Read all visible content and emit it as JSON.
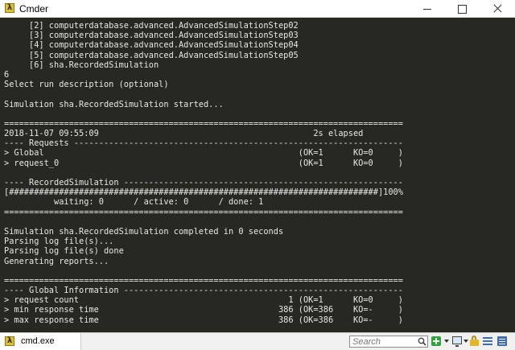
{
  "window": {
    "title": "Cmder",
    "icon": "lambda-icon",
    "app_glyph": "λ"
  },
  "terminal": {
    "background": "#272822",
    "foreground": "#e6e6e6",
    "lines": [
      "     [2] computerdatabase.advanced.AdvancedSimulationStep02",
      "     [3] computerdatabase.advanced.AdvancedSimulationStep03",
      "     [4] computerdatabase.advanced.AdvancedSimulationStep04",
      "     [5] computerdatabase.advanced.AdvancedSimulationStep05",
      "     [6] sha.RecordedSimulation",
      "6",
      "Select run description (optional)",
      "",
      "Simulation sha.RecordedSimulation started...",
      "",
      "================================================================================",
      "2018-11-07 09:55:09                                           2s elapsed",
      "---- Requests ------------------------------------------------------------------",
      "> Global                                                   (OK=1      KO=0     )",
      "> request_0                                                (OK=1      KO=0     )",
      "",
      "---- RecordedSimulation --------------------------------------------------------",
      "[##########################################################################]100%",
      "          waiting: 0      / active: 0      / done: 1",
      "================================================================================",
      "",
      "Simulation sha.RecordedSimulation completed in 0 seconds",
      "Parsing log file(s)...",
      "Parsing log file(s) done",
      "Generating reports...",
      "",
      "================================================================================",
      "---- Global Information --------------------------------------------------------",
      "> request count                                          1 (OK=1      KO=0     )",
      "> min response time                                    386 (OK=386    KO=-     )",
      "> max response time                                    386 (OK=386    KO=-     )"
    ]
  },
  "statusbar": {
    "tab_label": "cmd.exe",
    "search_placeholder": "Search"
  },
  "colors": {
    "tab_icon": "#d8c03a",
    "add_button": "#2ea43a",
    "accent_blue": "#3c6db0",
    "lock": "#e3b52c"
  }
}
